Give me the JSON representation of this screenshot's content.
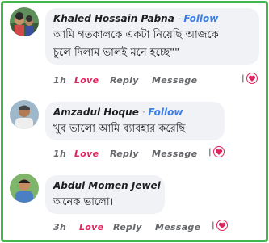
{
  "colors": {
    "frame": "#42b84a",
    "follow": "#3a7ee6",
    "love": "#e0245e",
    "bubble": "#f0f2f5"
  },
  "comments": [
    {
      "name": "Khaled Hossain Pabna",
      "separator": "·",
      "follow": "Follow",
      "lines": [
        "আমি গতকালকে একটা নিয়েছি আজকে",
        "চুলে দিলাম ভালই মনে হচ্ছে\"\""
      ],
      "time": "1h",
      "love": "Love",
      "reply": "Reply",
      "message": "Message",
      "reaction_sep": "|",
      "reaction_icon": "heart-icon"
    },
    {
      "name": "Amzadul Hoque",
      "separator": "·",
      "follow": "Follow",
      "lines": [
        "খুব ভালো আমি ব্যাবহার করেছি"
      ],
      "time": "1h",
      "love": "Love",
      "reply": "Reply",
      "message": "Message",
      "reaction_sep": "|",
      "reaction_icon": "heart-icon"
    },
    {
      "name": "Abdul Momen Jewel",
      "lines": [
        "অনেক ভালো।"
      ],
      "time": "3h",
      "love": "Love",
      "reply": "Reply",
      "message": "Message",
      "reaction_sep": "|",
      "reaction_icon": "heart-icon"
    }
  ]
}
